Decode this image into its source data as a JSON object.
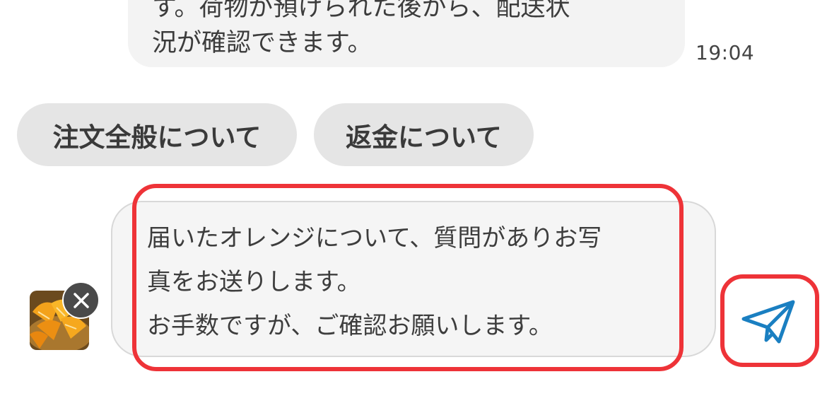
{
  "chat": {
    "incoming_message": {
      "text": "す。荷物が預けられた後から、配送状\n況が確認できます。",
      "time": "19:04"
    },
    "quick_replies": [
      "注文全般について",
      "返金について"
    ]
  },
  "composer": {
    "text": "届いたオレンジについて、質問がありお写\n真をお送りします。\nお手数ですが、ご確認お願いします。",
    "attachment_icon": "orange-photo",
    "remove_icon": "close-icon",
    "send_icon": "paper-plane-icon"
  },
  "colors": {
    "highlight": "#ee3338",
    "send_icon": "#1a7fc1",
    "bubble_bg": "#f3f3f3",
    "chip_bg": "#e5e5e5"
  }
}
